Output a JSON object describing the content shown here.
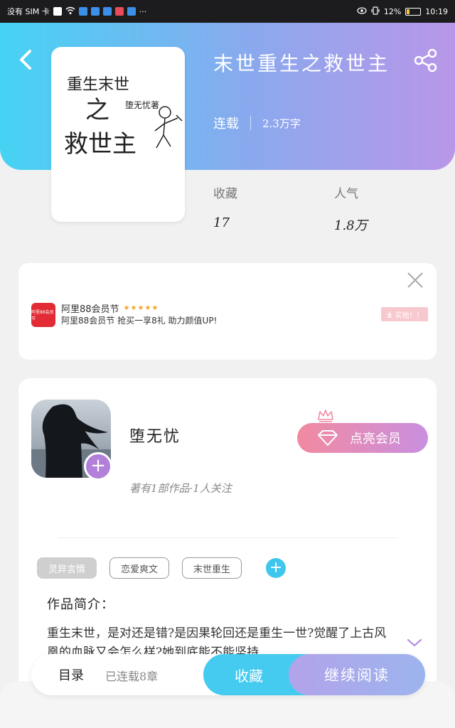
{
  "status_bar": {
    "carrier": "没有 SIM 卡",
    "battery": "12%",
    "time": "10:19"
  },
  "book": {
    "title": "末世重生之救世主",
    "status": "连载",
    "word_count": "2.3万字",
    "cover_text_main": "重生末世",
    "cover_text_mid": "之",
    "cover_text_bottom": "救世主",
    "cover_author": "堕无忧著"
  },
  "stats": [
    {
      "label": "收藏",
      "value": "17"
    },
    {
      "label": "人气",
      "value": "1.8万"
    }
  ],
  "ad": {
    "logo_text": "阿里88会员节",
    "title": "阿里88会员节",
    "stars": "★★★★★",
    "subtitle": "阿里88会员节 抢买一享8礼 助力颜值UP!",
    "button_label": "买他！！"
  },
  "author": {
    "name": "堕无忧",
    "meta": "著有1部作品·1人关注",
    "vip_button": "点亮会员"
  },
  "tags": [
    "灵异言情",
    "恋爱爽文",
    "末世重生"
  ],
  "intro": {
    "heading": "作品简介：",
    "text": "重生末世，是对还是错?是因果轮回还是重生一世?觉醒了上古风凰的血脉又会怎么样?她到底能不能坚持…"
  },
  "bottom_bar": {
    "toc_label": "目录",
    "toc_status": "已连载8章",
    "collect_label": "收藏",
    "read_label": "继续阅读"
  },
  "colors": {
    "hero_start": "#45d3f3",
    "hero_end": "#b996e8",
    "accent_blue": "#45cbf0",
    "accent_purple": "#b27fd9"
  }
}
